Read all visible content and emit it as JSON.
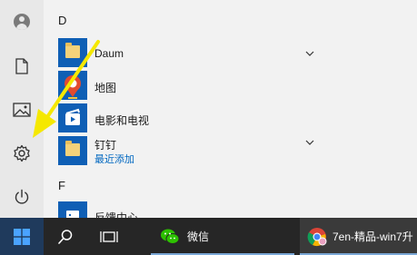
{
  "start_menu": {
    "letters": [
      "D",
      "F"
    ],
    "apps": [
      {
        "name": "Daum",
        "sub": "",
        "icon": "folder-icon",
        "expandable": true
      },
      {
        "name": "地图",
        "sub": "",
        "icon": "map-pin-icon",
        "expandable": false
      },
      {
        "name": "电影和电视",
        "sub": "",
        "icon": "movies-tv-icon",
        "expandable": false
      },
      {
        "name": "钉钉",
        "sub": "最近添加",
        "icon": "folder-icon",
        "expandable": true
      },
      {
        "name": "反馈中心",
        "sub": "",
        "icon": "feedback-hub-icon",
        "expandable": false
      }
    ],
    "rail": [
      "user-icon",
      "documents-icon",
      "pictures-icon",
      "settings-icon",
      "power-icon"
    ]
  },
  "taskbar": {
    "apps": [
      {
        "name": "微信",
        "icon": "wechat-icon"
      },
      {
        "name": "7en-精品-win7升",
        "icon": "chrome-icon"
      }
    ]
  },
  "colors": {
    "accent": "#0f5fb5",
    "taskbar": "#262626",
    "arrow": "#f5e800",
    "recently_added": "#0067c0"
  }
}
